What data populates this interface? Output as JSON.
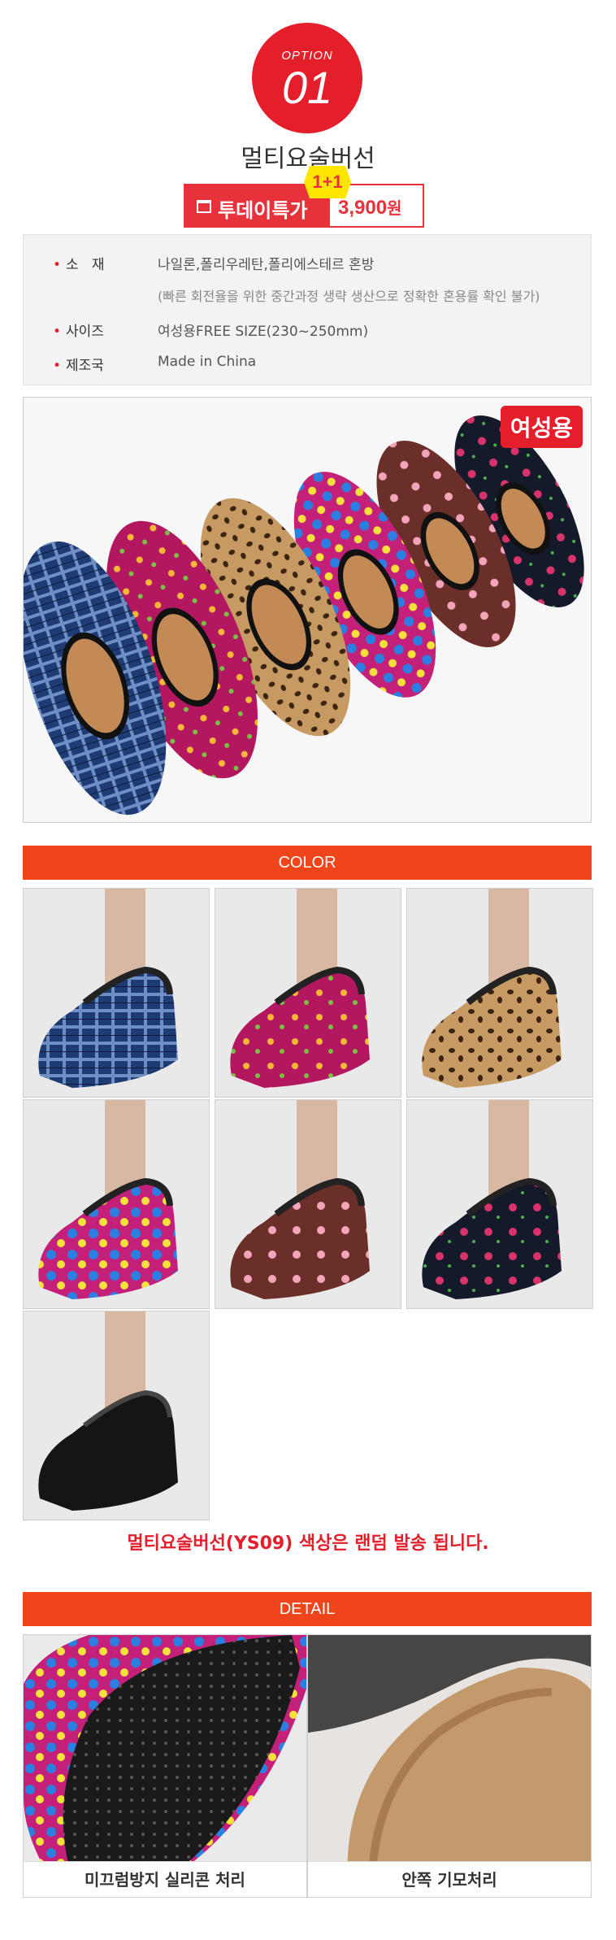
{
  "option": {
    "label": "OPTION",
    "number": "01"
  },
  "product": {
    "title": "멀티요술버선"
  },
  "deal": {
    "today_label": "투데이특가",
    "price": "3,900",
    "price_unit": "원",
    "bonus": "1+1"
  },
  "spec": {
    "material_label": "소   재",
    "material_value": "나일론,폴리우레탄,폴리에스테르 혼방",
    "material_note": "(빠른 회전율을 위한 중간과정 생략 생산으로 정확한 혼용률 확인 불가)",
    "size_label": "사이즈",
    "size_value": "여성용FREE SIZE(230~250mm)",
    "origin_label": "제조국",
    "origin_value": "Made in China"
  },
  "main_photo": {
    "tag": "여성용"
  },
  "sections": {
    "color_title": "COLOR",
    "detail_title": "DETAIL"
  },
  "color_notice": "멀티요술버선(YS09) 색상은 랜덤 발송 됩니다.",
  "color_patterns": [
    "blue-plaid",
    "magenta-floral",
    "leopard",
    "letter-print",
    "brown-floral",
    "black-floral",
    "black"
  ],
  "details": [
    {
      "caption": "미끄럼방지 실리콘 처리"
    },
    {
      "caption": "안쪽 기모처리"
    }
  ],
  "colors": {
    "accent": "#e51e2b",
    "section_bar": "#f0441b",
    "bonus_badge": "#ffe600"
  }
}
